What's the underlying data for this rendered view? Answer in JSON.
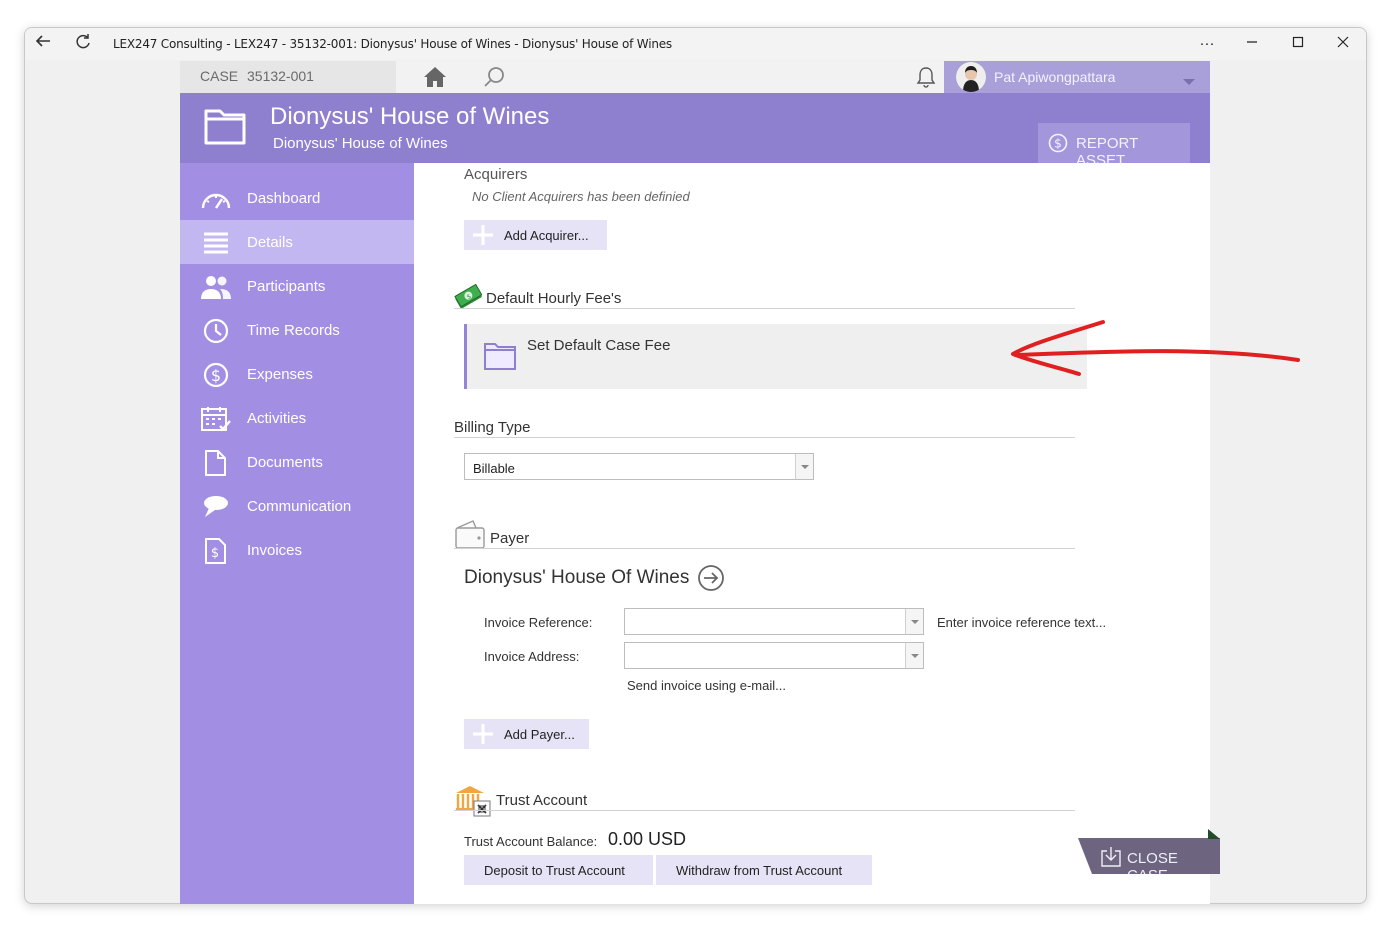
{
  "window": {
    "title": "LEX247 Consulting - LEX247 - 35132-001: Dionysus' House of Wines - Dionysus' House of Wines",
    "more_label": "···"
  },
  "topbar": {
    "case_label": "CASE",
    "case_number": "35132-001",
    "user_name": "Pat Apiwongpattara"
  },
  "header": {
    "title": "Dionysus' House of Wines",
    "subtitle": "Dionysus' House of Wines",
    "report_asset_label": "REPORT ASSET"
  },
  "sidebar": {
    "items": [
      {
        "label": "Dashboard",
        "icon": "gauge-icon",
        "active": false
      },
      {
        "label": "Details",
        "icon": "list-icon",
        "active": true
      },
      {
        "label": "Participants",
        "icon": "people-icon",
        "active": false
      },
      {
        "label": "Time Records",
        "icon": "clock-icon",
        "active": false
      },
      {
        "label": "Expenses",
        "icon": "dollar-circle-icon",
        "active": false
      },
      {
        "label": "Activities",
        "icon": "calendar-check-icon",
        "active": false
      },
      {
        "label": "Documents",
        "icon": "document-icon",
        "active": false
      },
      {
        "label": "Communication",
        "icon": "chat-icon",
        "active": false
      },
      {
        "label": "Invoices",
        "icon": "invoice-icon",
        "active": false
      }
    ]
  },
  "acquirers": {
    "title": "Acquirers",
    "empty_text": "No Client Acquirers has been definied",
    "add_label": "Add Acquirer..."
  },
  "hourly_fee": {
    "title": "Default Hourly Fee's",
    "set_label": "Set Default Case Fee"
  },
  "billing": {
    "title": "Billing Type",
    "value": "Billable"
  },
  "payer": {
    "title": "Payer",
    "name": "Dionysus' House Of Wines",
    "invoice_reference_label": "Invoice Reference:",
    "invoice_reference_hint": "Enter invoice reference text...",
    "invoice_address_label": "Invoice Address:",
    "send_email_label": "Send invoice using e-mail...",
    "add_label": "Add Payer..."
  },
  "trust": {
    "title": "Trust Account",
    "balance_label": "Trust Account Balance:",
    "balance_value": "0.00 USD",
    "deposit_label": "Deposit to Trust Account",
    "withdraw_label": "Withdraw from Trust Account"
  },
  "footer": {
    "close_case_label": "CLOSE CASE"
  },
  "colors": {
    "accent": "#8f7fcf",
    "sidebar": "#a28fe4",
    "active": "#c3b7f1",
    "arrow": "#e02020"
  }
}
